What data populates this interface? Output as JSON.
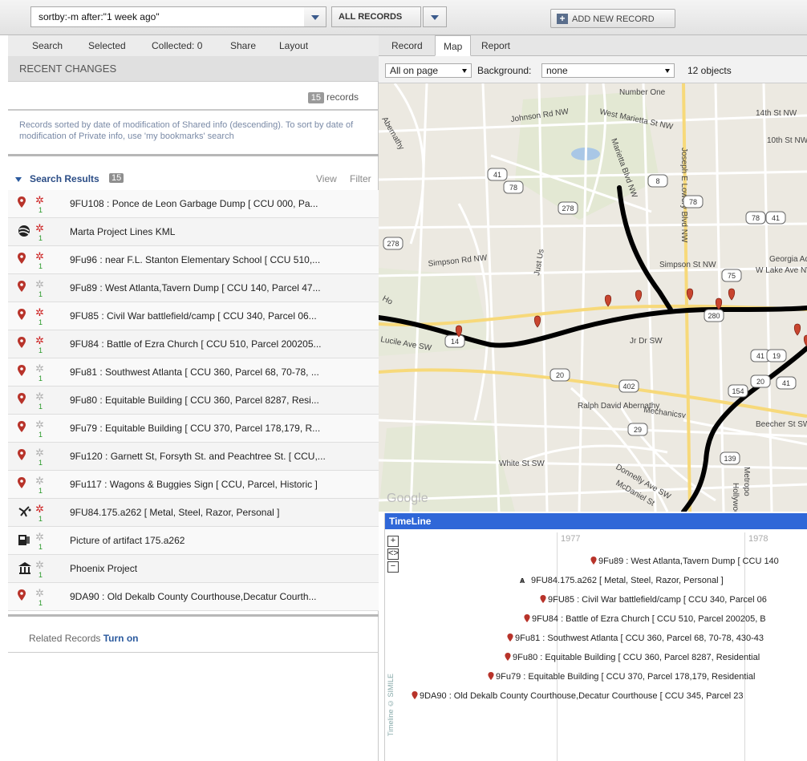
{
  "topbar": {
    "search_value": "sortby:-m after:\"1 week ago\"",
    "scope": "ALL RECORDS",
    "add_label": "ADD NEW RECORD"
  },
  "left": {
    "tabs": [
      "Search",
      "Selected",
      "Collected: 0",
      "Share",
      "Layout"
    ],
    "section_title": "RECENT CHANGES",
    "count_badge": "15",
    "count_label": "records",
    "sort_note": "Records sorted by date of modification of Shared info (descending). To sort by date of modification of Private info, use 'my bookmarks' search",
    "results_title": "Search Results",
    "results_badge": "15",
    "view_label": "View",
    "filter_label": "Filter",
    "related_label": "Related Records",
    "related_link": "Turn on",
    "rows": [
      {
        "icon": "map-pin-icon",
        "star": "red",
        "text": "9FU108 : Ponce de Leon Garbage Dump [ CCU 000, Pa..."
      },
      {
        "icon": "kml-layer-icon",
        "star": "red",
        "text": "Marta Project Lines KML"
      },
      {
        "icon": "map-pin-icon",
        "star": "red",
        "text": "9Fu96 : near F.L. Stanton Elementary School [ CCU 510,..."
      },
      {
        "icon": "map-pin-icon",
        "star": "gray",
        "text": "9Fu89 : West Atlanta,Tavern Dump [ CCU 140, Parcel 47..."
      },
      {
        "icon": "map-pin-icon",
        "star": "red",
        "text": "9FU85 : Civil War battlefield/camp [ CCU 340, Parcel 06..."
      },
      {
        "icon": "map-pin-icon",
        "star": "red",
        "text": "9FU84 : Battle of Ezra Church [ CCU 510, Parcel 200205..."
      },
      {
        "icon": "map-pin-icon",
        "star": "gray",
        "text": "9Fu81 : Southwest Atlanta [ CCU 360, Parcel 68, 70-78, ..."
      },
      {
        "icon": "map-pin-icon",
        "star": "gray",
        "text": "9Fu80 : Equitable Building [ CCU 360, Parcel 8287, Resi..."
      },
      {
        "icon": "map-pin-icon",
        "star": "gray",
        "text": "9Fu79 : Equitable Building [ CCU 370, Parcel 178,179, R..."
      },
      {
        "icon": "map-pin-icon",
        "star": "gray",
        "text": "9Fu120 : Garnett St, Forsyth St. and Peachtree St. [ CCU,..."
      },
      {
        "icon": "map-pin-icon",
        "star": "gray",
        "text": "9Fu117 : Wagons & Buggies Sign [ CCU, Parcel, Historic ]"
      },
      {
        "icon": "artifact-icon",
        "star": "red",
        "text": "9FU84.175.a262 [ Metal, Steel, Razor, Personal ]"
      },
      {
        "icon": "media-icon",
        "star": "gray",
        "text": "Picture of artifact 175.a262"
      },
      {
        "icon": "project-icon",
        "star": "gray",
        "text": "Phoenix Project"
      },
      {
        "icon": "map-pin-icon",
        "star": "gray",
        "text": "9DA90 : Old Dekalb County Courthouse,Decatur Courth..."
      }
    ],
    "row_count_marker": "1"
  },
  "right": {
    "tabs": [
      "Record",
      "Map",
      "Report"
    ],
    "active_tab": "Map",
    "show_select": "All on page",
    "background_label": "Background:",
    "background_select": "none",
    "objects": "12 objects",
    "map_labels": [
      "Number One",
      "Johnson Rd NW",
      "West Marietta St NW",
      "14th St NW",
      "10th St NW",
      "Marietta Blvd NW",
      "Joseph E Lowery Blvd NW",
      "Simpson Rd NW",
      "Simpson St NW",
      "Georgia Aquarium",
      "W Lake Ave NW",
      "Just Us",
      "Jr Dr SW",
      "Lucile Ave SW",
      "Ralph David Abernathy",
      "Mechanicsv",
      "Beecher St SW",
      "White St SW",
      "Donnelly Ave SW",
      "McDaniel St",
      "Metropo",
      "Hollywood Rd NW",
      "Abernathy",
      "Ho"
    ],
    "road_shields": [
      "41",
      "78",
      "278",
      "8",
      "78",
      "78",
      "41",
      "278",
      "280",
      "41",
      "19",
      "14",
      "20",
      "402",
      "20",
      "154",
      "29",
      "139",
      "41",
      "75"
    ],
    "timeline": {
      "title": "TimeLine",
      "years": [
        "1977",
        "1978"
      ],
      "zoom_in": "+",
      "zoom_mid": "<>",
      "zoom_out": "−",
      "events": [
        "9Fu89 : West Atlanta,Tavern Dump [ CCU 140",
        "9FU84.175.a262 [ Metal, Steel, Razor, Personal ]",
        "9FU85 : Civil War battlefield/camp [ CCU 340, Parcel 06",
        "9FU84 : Battle of Ezra Church [ CCU 510, Parcel 200205, B",
        "9Fu81 : Southwest Atlanta [ CCU 360, Parcel 68, 70-78, 430-43",
        "9Fu80 : Equitable Building [ CCU 360, Parcel 8287, Residential",
        "9Fu79 : Equitable Building [ CCU 370, Parcel 178,179, Residential",
        "9DA90 : Old Dekalb County Courthouse,Decatur Courthouse [ CCU 345, Parcel 23"
      ],
      "credit": "Timeline © SIMILE"
    }
  },
  "colors": {
    "accent": "#2f67d8",
    "pin": "#c0392b",
    "star_red": "#cc2222",
    "star_gray": "#b0b0b0",
    "count_green": "#2a9a2a"
  }
}
